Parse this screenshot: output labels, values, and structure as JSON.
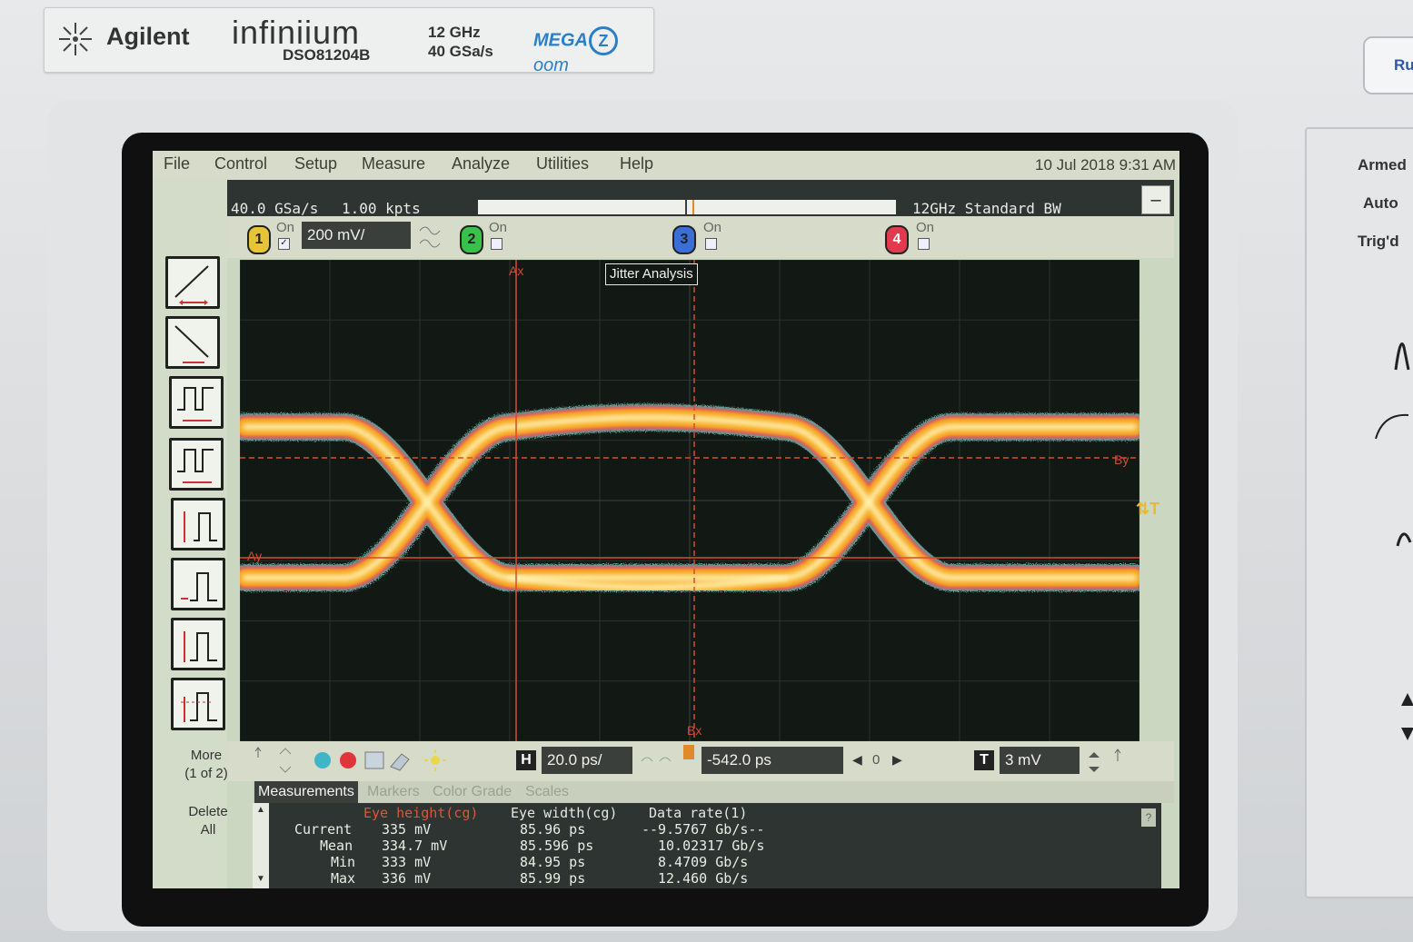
{
  "brand": {
    "company": "Agilent",
    "product": "infiniium",
    "model": "DSO81204B",
    "spec_bw": "12 GHz",
    "spec_rate": "40 GSa/s",
    "megazoom_prefix": "MEGA",
    "megazoom_z": "Z",
    "megazoom_suffix": "oom"
  },
  "hardware": {
    "run_label": "Ru",
    "side_labels": [
      "Armed",
      "Auto",
      "Trig'd"
    ]
  },
  "menu": {
    "items": [
      "File",
      "Control",
      "Setup",
      "Measure",
      "Analyze",
      "Utilities",
      "Help"
    ],
    "datetime": "10 Jul 2018  9:31 AM"
  },
  "acquisition": {
    "sample_rate": "40.0 GSa/s",
    "points": "1.00 kpts",
    "bandwidth": "12GHz Standard BW",
    "minimize": "–"
  },
  "channels": [
    {
      "num": "1",
      "on_label": "On",
      "checked": "✓",
      "color": "#e8c338",
      "scale": "200 mV/"
    },
    {
      "num": "2",
      "on_label": "On",
      "checked": "",
      "color": "#38c24a"
    },
    {
      "num": "3",
      "on_label": "On",
      "checked": "",
      "color": "#3b6fd8"
    },
    {
      "num": "4",
      "on_label": "On",
      "checked": "",
      "color": "#e03a4c"
    }
  ],
  "toolbar_left": {
    "more": "More",
    "more_page": "(1 of 2)",
    "delete": "Delete",
    "delete_all": "All"
  },
  "plot": {
    "title": "Jitter Analysis",
    "marker_ax": "Ax",
    "marker_bx": "Bx",
    "marker_ay": "Ay",
    "marker_by": "By",
    "trigger_icon": "⇅T",
    "colors": {
      "background": "#121814",
      "eye_core": "#fff2b0",
      "eye_mid": "#f6a51e",
      "eye_edge": "#e04a6a",
      "eye_fringe": "#3fc8b0",
      "marker": "#d84a2f"
    }
  },
  "controls": {
    "h_label": "H",
    "timebase": "20.0 ps/",
    "delay": "-542.0 ps",
    "delay_ref": "0",
    "t_label": "T",
    "trigger_level": "3 mV"
  },
  "tabs": [
    "Measurements",
    "Markers",
    "Color Grade",
    "Scales"
  ],
  "measurements": {
    "headers": [
      "Eye height(cg)",
      "Eye width(cg)",
      "Data rate(1)"
    ],
    "rows": [
      {
        "label": "Current",
        "values": [
          "335 mV",
          "85.96 ps",
          "--9.5767 Gb/s--"
        ]
      },
      {
        "label": "Mean",
        "values": [
          "334.7 mV",
          "85.596 ps",
          "10.02317 Gb/s"
        ]
      },
      {
        "label": "Min",
        "values": [
          "333 mV",
          "84.95 ps",
          "8.4709 Gb/s"
        ]
      },
      {
        "label": "Max",
        "values": [
          "336 mV",
          "85.99 ps",
          "12.460 Gb/s"
        ]
      }
    ],
    "help": "?"
  }
}
